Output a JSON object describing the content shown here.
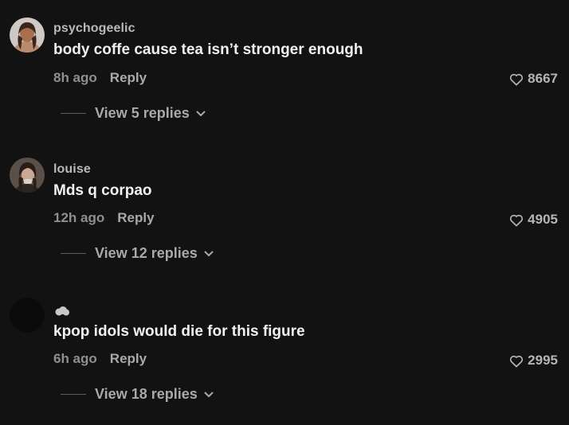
{
  "comments": [
    {
      "username": "psychogeelic",
      "text": "body coffe cause tea isn’t stronger enough",
      "time": "8h ago",
      "reply_label": "Reply",
      "likes": "8667",
      "view_replies": "View 5 replies"
    },
    {
      "username": "louise",
      "text": "Mds q corpao",
      "time": "12h ago",
      "reply_label": "Reply",
      "likes": "4905",
      "view_replies": "View 12 replies"
    },
    {
      "username": "",
      "text": "kpop idols would die for this figure",
      "time": "6h ago",
      "reply_label": "Reply",
      "likes": "2995",
      "view_replies": "View 18 replies"
    }
  ],
  "icons": {
    "like": "heart-icon",
    "expand": "chevron-down-icon",
    "username_badge": "cloud-icon"
  },
  "colors": {
    "background": "#121212",
    "username": "#b9b9b9",
    "text": "#f1f1f1",
    "muted": "#8f8f8f"
  }
}
